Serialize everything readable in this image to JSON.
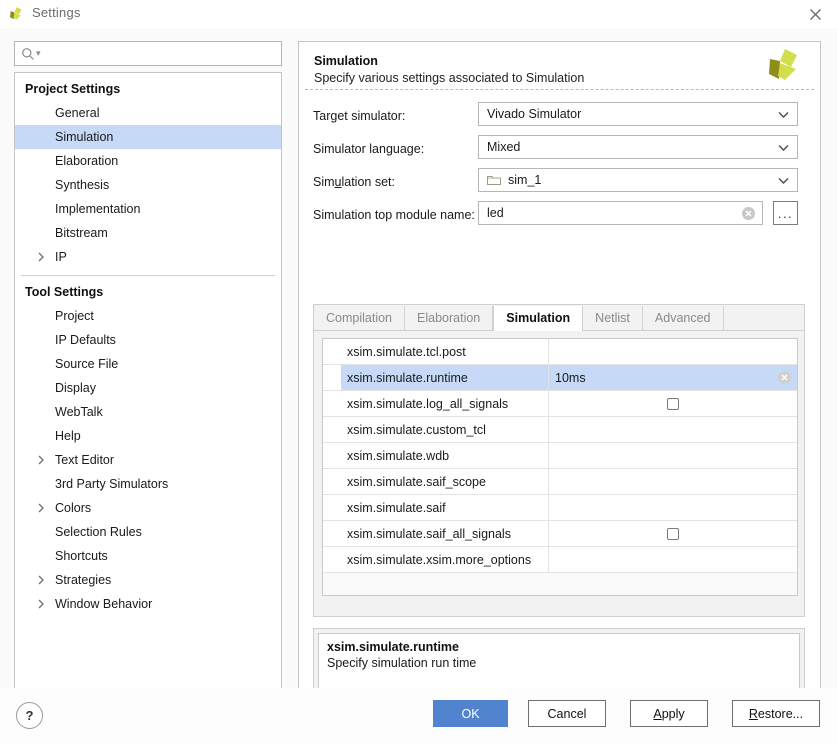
{
  "window": {
    "title": "Settings",
    "logo_icon": "vivado-logo-icon",
    "close_icon": "close-icon"
  },
  "sidebar": {
    "search": {
      "placeholder": "",
      "value": "",
      "icon": "search-icon"
    },
    "groups": [
      {
        "label": "Project Settings",
        "items": [
          {
            "label": "General",
            "expandable": false,
            "selected": false
          },
          {
            "label": "Simulation",
            "expandable": false,
            "selected": true
          },
          {
            "label": "Elaboration",
            "expandable": false,
            "selected": false
          },
          {
            "label": "Synthesis",
            "expandable": false,
            "selected": false
          },
          {
            "label": "Implementation",
            "expandable": false,
            "selected": false
          },
          {
            "label": "Bitstream",
            "expandable": false,
            "selected": false
          },
          {
            "label": "IP",
            "expandable": true,
            "selected": false
          }
        ]
      },
      {
        "label": "Tool Settings",
        "items": [
          {
            "label": "Project",
            "expandable": false,
            "selected": false
          },
          {
            "label": "IP Defaults",
            "expandable": false,
            "selected": false
          },
          {
            "label": "Source File",
            "expandable": false,
            "selected": false
          },
          {
            "label": "Display",
            "expandable": false,
            "selected": false
          },
          {
            "label": "WebTalk",
            "expandable": false,
            "selected": false
          },
          {
            "label": "Help",
            "expandable": false,
            "selected": false
          },
          {
            "label": "Text Editor",
            "expandable": true,
            "selected": false
          },
          {
            "label": "3rd Party Simulators",
            "expandable": false,
            "selected": false
          },
          {
            "label": "Colors",
            "expandable": true,
            "selected": false
          },
          {
            "label": "Selection Rules",
            "expandable": false,
            "selected": false
          },
          {
            "label": "Shortcuts",
            "expandable": false,
            "selected": false
          },
          {
            "label": "Strategies",
            "expandable": true,
            "selected": false
          },
          {
            "label": "Window Behavior",
            "expandable": true,
            "selected": false
          }
        ]
      }
    ]
  },
  "panel": {
    "title": "Simulation",
    "subtitle": "Specify various settings associated to Simulation",
    "logo_icon": "vivado-logo-icon",
    "fields": [
      {
        "label": "Target simulator:",
        "value": "Vivado Simulator",
        "type": "select",
        "mnemonic_index": -1
      },
      {
        "label": "Simulator language:",
        "value": "Mixed",
        "type": "select",
        "mnemonic_index": -1
      },
      {
        "label": "Simulation set:",
        "value": "sim_1",
        "type": "select-folder",
        "icon": "folder-icon"
      },
      {
        "label": "Simulation top module name:",
        "value": "led",
        "type": "text-clear",
        "icon": "clear-circle-icon",
        "browse_label": "..."
      }
    ],
    "tabs": [
      {
        "label": "Compilation",
        "active": false
      },
      {
        "label": "Elaboration",
        "active": false
      },
      {
        "label": "Simulation",
        "active": true
      },
      {
        "label": "Netlist",
        "active": false
      },
      {
        "label": "Advanced",
        "active": false
      }
    ],
    "table": {
      "rows": [
        {
          "name": "xsim.simulate.tcl.post",
          "value": "",
          "kind": "text",
          "selected": false
        },
        {
          "name": "xsim.simulate.runtime",
          "value": "10ms",
          "kind": "text-clear",
          "selected": true
        },
        {
          "name": "xsim.simulate.log_all_signals",
          "value": "",
          "kind": "checkbox",
          "checked": false,
          "selected": false
        },
        {
          "name": "xsim.simulate.custom_tcl",
          "value": "",
          "kind": "text",
          "selected": false
        },
        {
          "name": "xsim.simulate.wdb",
          "value": "",
          "kind": "text",
          "selected": false
        },
        {
          "name": "xsim.simulate.saif_scope",
          "value": "",
          "kind": "text",
          "selected": false
        },
        {
          "name": "xsim.simulate.saif",
          "value": "",
          "kind": "text",
          "selected": false
        },
        {
          "name": "xsim.simulate.saif_all_signals",
          "value": "",
          "kind": "checkbox",
          "checked": false,
          "selected": false
        },
        {
          "name": "xsim.simulate.xsim.more_options",
          "value": "",
          "kind": "text",
          "selected": false
        }
      ]
    },
    "description": {
      "title": "xsim.simulate.runtime",
      "body": "Specify simulation run time"
    }
  },
  "footer": {
    "help_label": "?",
    "buttons": [
      {
        "id": "btn-ok",
        "label": "OK",
        "primary": true,
        "mnemonic": ""
      },
      {
        "id": "btn-cancel",
        "label": "Cancel",
        "primary": false,
        "mnemonic": ""
      },
      {
        "id": "btn-apply",
        "label": "Apply",
        "primary": false,
        "mnemonic": "A"
      },
      {
        "id": "btn-restore",
        "label": "Restore...",
        "primary": false,
        "mnemonic": "R"
      }
    ]
  },
  "colors": {
    "accent_blue": "#5183ce",
    "selection_blue": "#c6daf7",
    "logo_olive": "#8f8c17",
    "logo_lime": "#d2de4c",
    "panel_border": "#c4c4c4"
  }
}
